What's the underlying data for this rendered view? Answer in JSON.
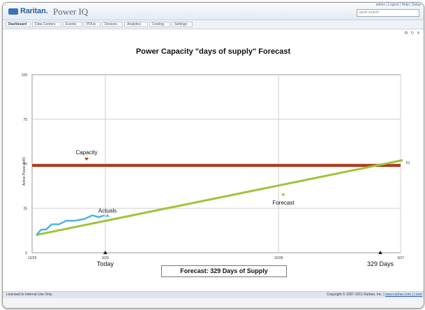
{
  "app": {
    "brand": "Raritan.",
    "product": "Power IQ",
    "user_links": "admin | Logout | Help | Setup",
    "search_placeholder": "quick search"
  },
  "nav": {
    "tabs": [
      {
        "label": "Dashboard",
        "active": true
      },
      {
        "label": "Data Centers",
        "active": false
      },
      {
        "label": "Events",
        "active": false
      },
      {
        "label": "PDUs",
        "active": false
      },
      {
        "label": "Devices",
        "active": false
      },
      {
        "label": "Analytics",
        "active": false
      },
      {
        "label": "Cooling",
        "active": false
      },
      {
        "label": "Settings",
        "active": false
      }
    ],
    "portlet_icons": [
      "settings-icon",
      "refresh-icon",
      "close-icon"
    ]
  },
  "chart_data": {
    "type": "line",
    "title": "Power Capacity \"days of supply\" Forecast",
    "ylabel": "Active Power (kW)",
    "ylim": [
      0,
      100
    ],
    "y_ticks": [
      "100",
      "75",
      "50",
      "25",
      "0"
    ],
    "x_ticks": [
      {
        "label": "12/29",
        "date": "12/29"
      },
      {
        "label": "3/29",
        "date": "3/29"
      },
      {
        "label": "10/28",
        "date": "10/28"
      },
      {
        "label": "3/27",
        "date": "3/27"
      }
    ],
    "grid": true,
    "series": [
      {
        "name": "Capacity",
        "color": "#b23a1d",
        "x": [
          "12/29",
          "3/27"
        ],
        "y": [
          49,
          49
        ]
      },
      {
        "name": "Actuals",
        "color": "#4ab7e6",
        "x": [
          "12/29",
          "1/4",
          "1/10",
          "1/17",
          "1/26",
          "2/4",
          "2/14",
          "2/26",
          "3/8",
          "3/16",
          "3/23"
        ],
        "y": [
          10,
          13,
          13,
          16,
          16,
          18,
          18,
          19,
          21,
          20,
          21
        ]
      },
      {
        "name": "Forecast",
        "color": "#9fc43a",
        "x": [
          "12/29",
          "3/27"
        ],
        "y": [
          10,
          52
        ]
      }
    ],
    "right_axis_label": "51",
    "annotations": {
      "today": "Today",
      "days": "329 Days",
      "forecast_box": "Forecast: 329 Days of Supply"
    }
  },
  "footer": {
    "license": "Licensed to Internal Use Only",
    "copyright": "Copyright © 2007-2011 Raritan, Inc. |",
    "link": "www.raritan.com | Licen"
  }
}
